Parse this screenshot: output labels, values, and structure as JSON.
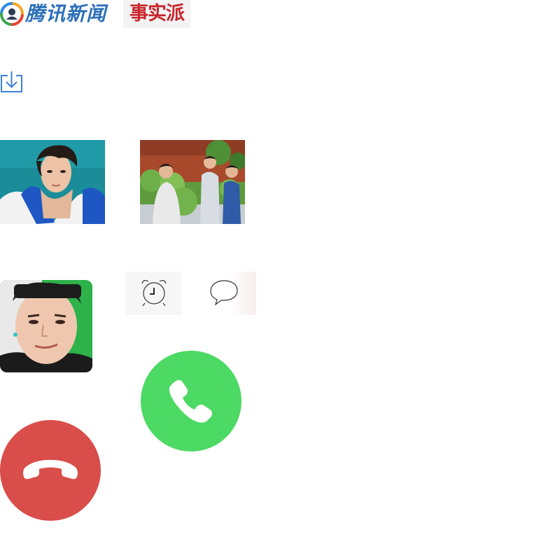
{
  "header": {
    "tencent_logo_text": "腾讯新闻",
    "fact_logo_text": "事实派"
  },
  "icons": {
    "download": "download-icon",
    "alarm": "alarm-clock-icon",
    "message": "speech-bubble-icon",
    "accept": "phone-icon",
    "decline": "phone-hangup-icon"
  },
  "colors": {
    "brand_blue": "#2b6fb8",
    "fact_red": "#c8262c",
    "accept_green": "#4cd964",
    "decline_red": "#d94d4a"
  }
}
